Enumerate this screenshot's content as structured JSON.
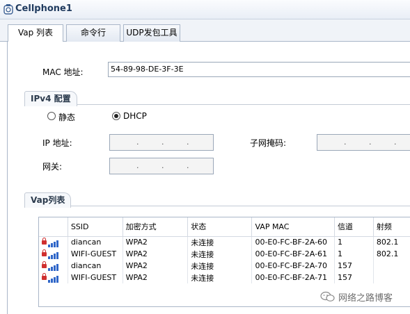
{
  "window": {
    "title": "Cellphone1"
  },
  "tabs": [
    {
      "label": "Vap 列表",
      "active": true
    },
    {
      "label": "命令行",
      "active": false
    },
    {
      "label": "UDP发包工具",
      "active": false
    }
  ],
  "mac": {
    "label": "MAC 地址:",
    "value": "54-89-98-DE-3F-3E"
  },
  "ipv4": {
    "group_title": "IPv4 配置",
    "static_label": "静态",
    "dhcp_label": "DHCP",
    "selected": "DHCP",
    "ip_label": "IP 地址:",
    "mask_label": "子网掩码:",
    "gateway_label": "网关:"
  },
  "vap": {
    "group_title": "Vap列表",
    "columns": [
      "SSID",
      "加密方式",
      "状态",
      "VAP MAC",
      "信道",
      "射频"
    ],
    "rows": [
      {
        "ssid": "diancan",
        "encryption": "WPA2",
        "status": "未连接",
        "vap_mac": "00-E0-FC-BF-2A-60",
        "channel": "1",
        "radio": "802.1"
      },
      {
        "ssid": "WIFI-GUEST",
        "encryption": "WPA2",
        "status": "未连接",
        "vap_mac": "00-E0-FC-BF-2A-61",
        "channel": "1",
        "radio": "802.1"
      },
      {
        "ssid": "diancan",
        "encryption": "WPA2",
        "status": "未连接",
        "vap_mac": "00-E0-FC-BF-2A-70",
        "channel": "157",
        "radio": ""
      },
      {
        "ssid": "WIFI-GUEST",
        "encryption": "WPA2",
        "status": "未连接",
        "vap_mac": "00-E0-FC-BF-2A-71",
        "channel": "157",
        "radio": ""
      }
    ]
  },
  "watermark": {
    "text": "网络之路博客",
    "icon": "wechat-icon"
  },
  "colors": {
    "accent": "#2f66c8",
    "lock": "#d03030",
    "title": "#1f3a5e"
  }
}
